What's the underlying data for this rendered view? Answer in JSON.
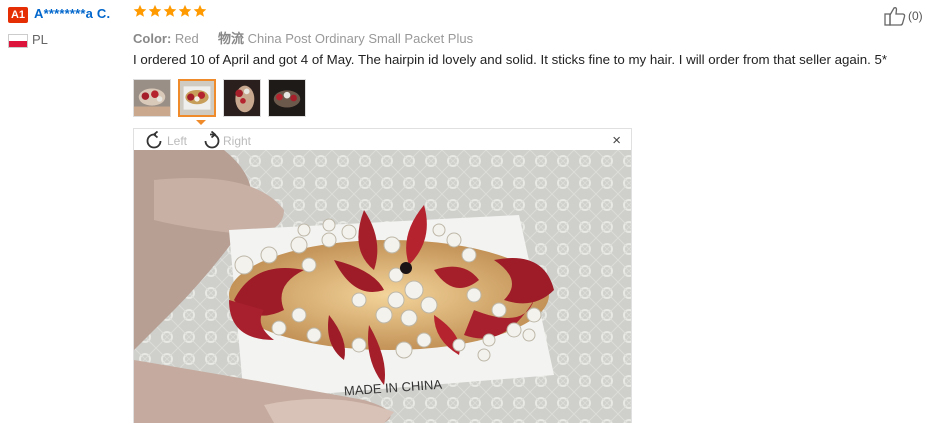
{
  "reviewer": {
    "badge": "A1",
    "name": "A********a C.",
    "country": "PL",
    "flag_colors": [
      "#ffffff",
      "#dc143c"
    ]
  },
  "rating": {
    "stars": 5,
    "max": 5,
    "color": "#ff9a00"
  },
  "attributes": {
    "color_label": "Color:",
    "color_value": "Red",
    "shipping_label": "物流",
    "shipping_value": "China Post Ordinary Small Packet Plus"
  },
  "review_text": "I ordered 10 of April and got 4 of May. The hairpin id lovely and solid. It sticks fine to my hair. I will order from that seller again. 5*",
  "thumbnails": [
    {
      "name": "photo-1",
      "active": false
    },
    {
      "name": "photo-2",
      "active": true
    },
    {
      "name": "photo-3",
      "active": false
    },
    {
      "name": "photo-4",
      "active": false
    }
  ],
  "viewer": {
    "rotate_left_label": "Left",
    "rotate_right_label": "Right",
    "close_label": "×",
    "photo_caption_text": "MADE IN CHINA"
  },
  "helpful": {
    "icon": "thumbs-up-icon",
    "count": "(0)"
  },
  "colors": {
    "accent_orange": "#f08b2c",
    "link_blue": "#0066cc",
    "badge_red": "#e62e04"
  }
}
